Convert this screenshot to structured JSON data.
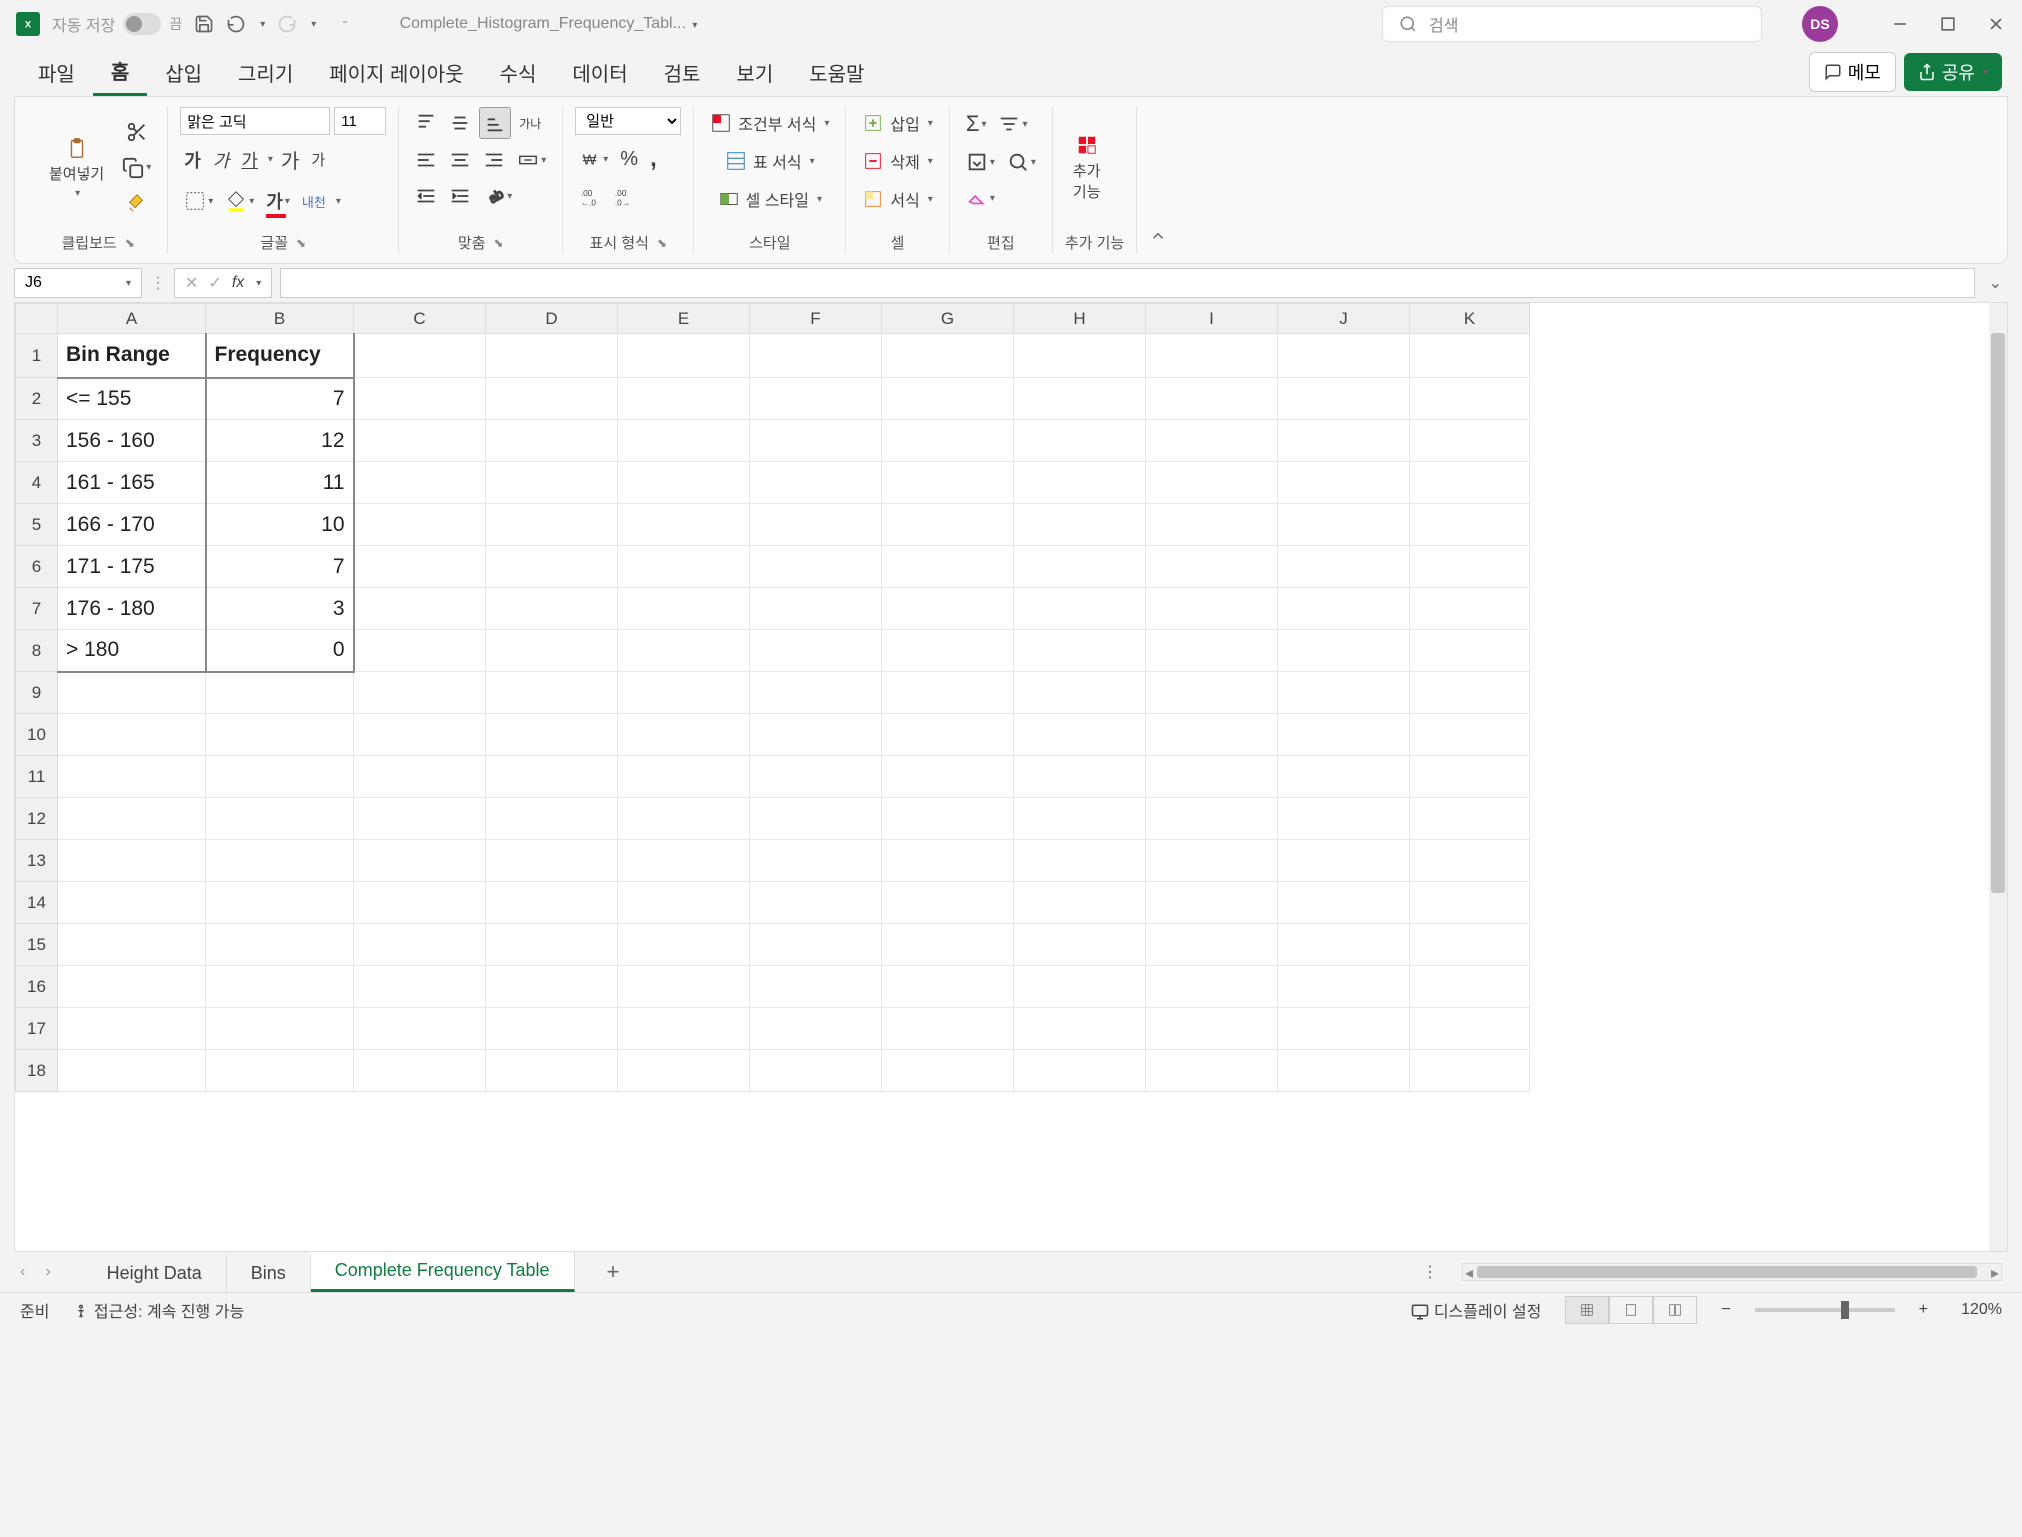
{
  "titlebar": {
    "autosave_label": "자동 저장",
    "autosave_state": "끔",
    "doc_title": "Complete_Histogram_Frequency_Tabl...",
    "search_placeholder": "검색",
    "user_initials": "DS"
  },
  "menu": {
    "file": "파일",
    "home": "홈",
    "insert": "삽입",
    "draw": "그리기",
    "page_layout": "페이지 레이아웃",
    "formulas": "수식",
    "data": "데이터",
    "review": "검토",
    "view": "보기",
    "help": "도움말",
    "memo": "메모",
    "share": "공유"
  },
  "ribbon": {
    "clipboard": {
      "paste": "붙여넣기",
      "label": "클립보드"
    },
    "font": {
      "name": "맑은 고딕",
      "size": "11",
      "label": "글꼴",
      "bold": "가",
      "italic": "가",
      "underline": "가",
      "grow": "가",
      "shrink": "가",
      "hanja": "내천"
    },
    "align": {
      "label": "맞춤",
      "text_ctrl": "가나"
    },
    "number": {
      "format": "일반",
      "label": "표시 형식"
    },
    "styles": {
      "cond": "조건부 서식",
      "table": "표 서식",
      "cell": "셀 스타일",
      "label": "스타일"
    },
    "cells": {
      "insert": "삽입",
      "delete": "삭제",
      "format": "서식",
      "label": "셀"
    },
    "editing": {
      "label": "편집"
    },
    "addins": {
      "btn": "추가\n기능",
      "label": "추가 기능"
    }
  },
  "formula_bar": {
    "name_box": "J6",
    "fx": "fx",
    "formula": ""
  },
  "grid": {
    "col_headers": [
      "A",
      "B",
      "C",
      "D",
      "E",
      "F",
      "G",
      "H",
      "I",
      "J",
      "K"
    ],
    "row_headers": [
      "1",
      "2",
      "3",
      "4",
      "5",
      "6",
      "7",
      "8",
      "9",
      "10",
      "11",
      "12",
      "13",
      "14",
      "15",
      "16",
      "17",
      "18"
    ],
    "data": {
      "A1": "Bin Range",
      "B1": "Frequency",
      "A2": "<= 155",
      "B2": "7",
      "A3": "156 - 160",
      "B3": "12",
      "A4": "161 - 165",
      "B4": "11",
      "A5": "166 - 170",
      "B5": "10",
      "A6": "171 - 175",
      "B6": "7",
      "A7": "176 - 180",
      "B7": "3",
      "A8": "> 180",
      "B8": "0"
    }
  },
  "sheets": {
    "tab1": "Height Data",
    "tab2": "Bins",
    "tab3": "Complete Frequency Table"
  },
  "status": {
    "ready": "준비",
    "accessibility": "접근성: 계속 진행 가능",
    "display": "디스플레이 설정",
    "zoom": "120%"
  }
}
